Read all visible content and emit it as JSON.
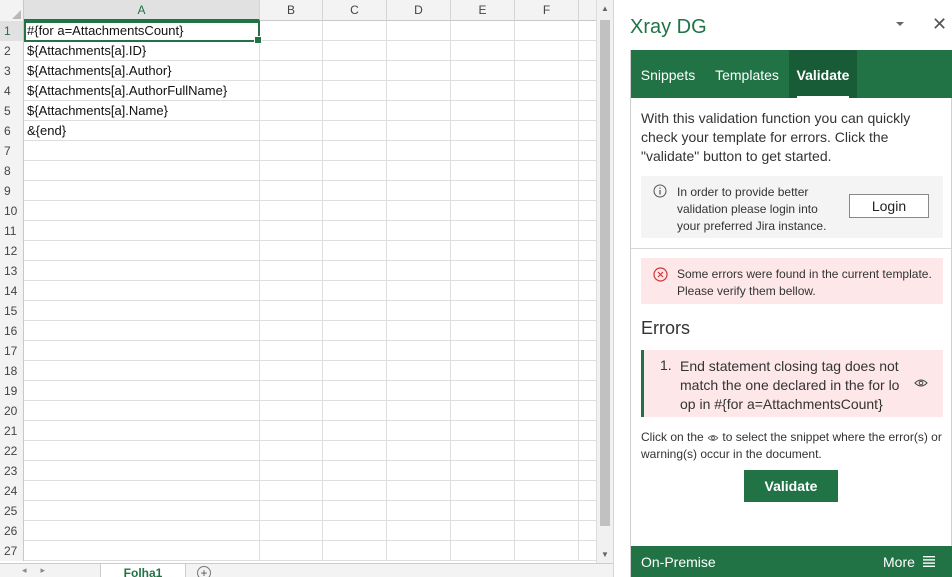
{
  "sheet": {
    "columns": [
      "A",
      "B",
      "C",
      "D",
      "E",
      "F"
    ],
    "rows": [
      "1",
      "2",
      "3",
      "4",
      "5",
      "6",
      "7",
      "8",
      "9",
      "10",
      "11",
      "12",
      "13",
      "14",
      "15",
      "16",
      "17",
      "18",
      "19",
      "20",
      "21",
      "22",
      "23",
      "24",
      "25",
      "26",
      "27"
    ],
    "cells_a": [
      "#{for a=AttachmentsCount}",
      "${Attachments[a].ID}",
      "${Attachments[a].Author}",
      "${Attachments[a].AuthorFullName}",
      "${Attachments[a].Name}",
      "&{end}"
    ],
    "active_cell": "A1",
    "sheet_tab": "Folha1",
    "add_sheet": "+"
  },
  "panel": {
    "title": "Xray DG",
    "close": "✕",
    "tabs": [
      "Snippets",
      "Templates",
      "Validate"
    ],
    "active_tab": "Validate",
    "intro": "With this validation function you can quickly check your template for errors. Click the \"validate\" button to get started.",
    "login_notice": "In order to provide better validation please login into your preferred Jira instance.",
    "login_button": "Login",
    "error_banner": "Some errors were found in the current template. Please verify them bellow.",
    "errors_heading": "Errors",
    "errors": [
      {
        "number": "1.",
        "message": "End statement closing tag does not match the one declared in the for lo op in #{for a=AttachmentsCount}"
      }
    ],
    "hint_before": "Click on the",
    "hint_after": "to select the snippet where the error(s) or warning(s) occur in the document.",
    "validate_button": "Validate",
    "footer_left": "On-Premise",
    "footer_right": "More"
  },
  "colors": {
    "accent": "#217346",
    "accent_dark": "#185c37",
    "error_bg": "#fde7e9",
    "error_icon": "#d13438"
  }
}
